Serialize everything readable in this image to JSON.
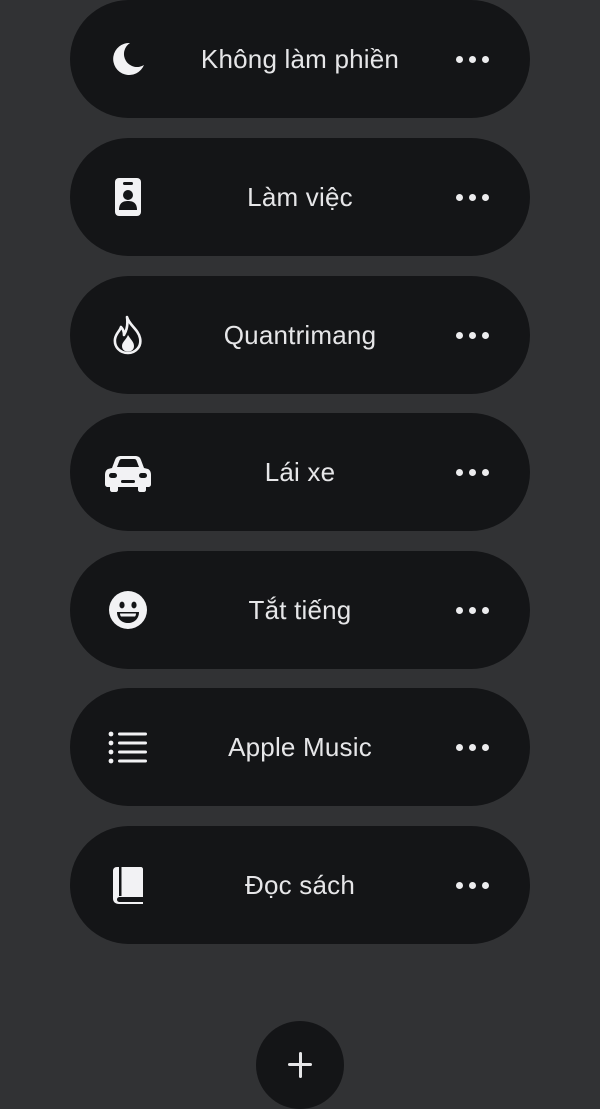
{
  "focus_modes": [
    {
      "id": "do-not-disturb",
      "label": "Không làm phiền",
      "icon": "moon-icon"
    },
    {
      "id": "work",
      "label": "Làm việc",
      "icon": "id-badge-icon"
    },
    {
      "id": "quantrimang",
      "label": "Quantrimang",
      "icon": "flame-icon"
    },
    {
      "id": "driving",
      "label": "Lái xe",
      "icon": "car-icon"
    },
    {
      "id": "mute",
      "label": "Tắt tiếng",
      "icon": "smiley-icon"
    },
    {
      "id": "apple-music",
      "label": "Apple Music",
      "icon": "list-icon"
    },
    {
      "id": "reading",
      "label": "Đọc sách",
      "icon": "book-icon"
    }
  ],
  "more_icon": "ellipsis-icon",
  "add_icon": "plus-icon",
  "colors": {
    "background": "#313234",
    "pill": "#141517",
    "text": "#e6e6e8"
  }
}
